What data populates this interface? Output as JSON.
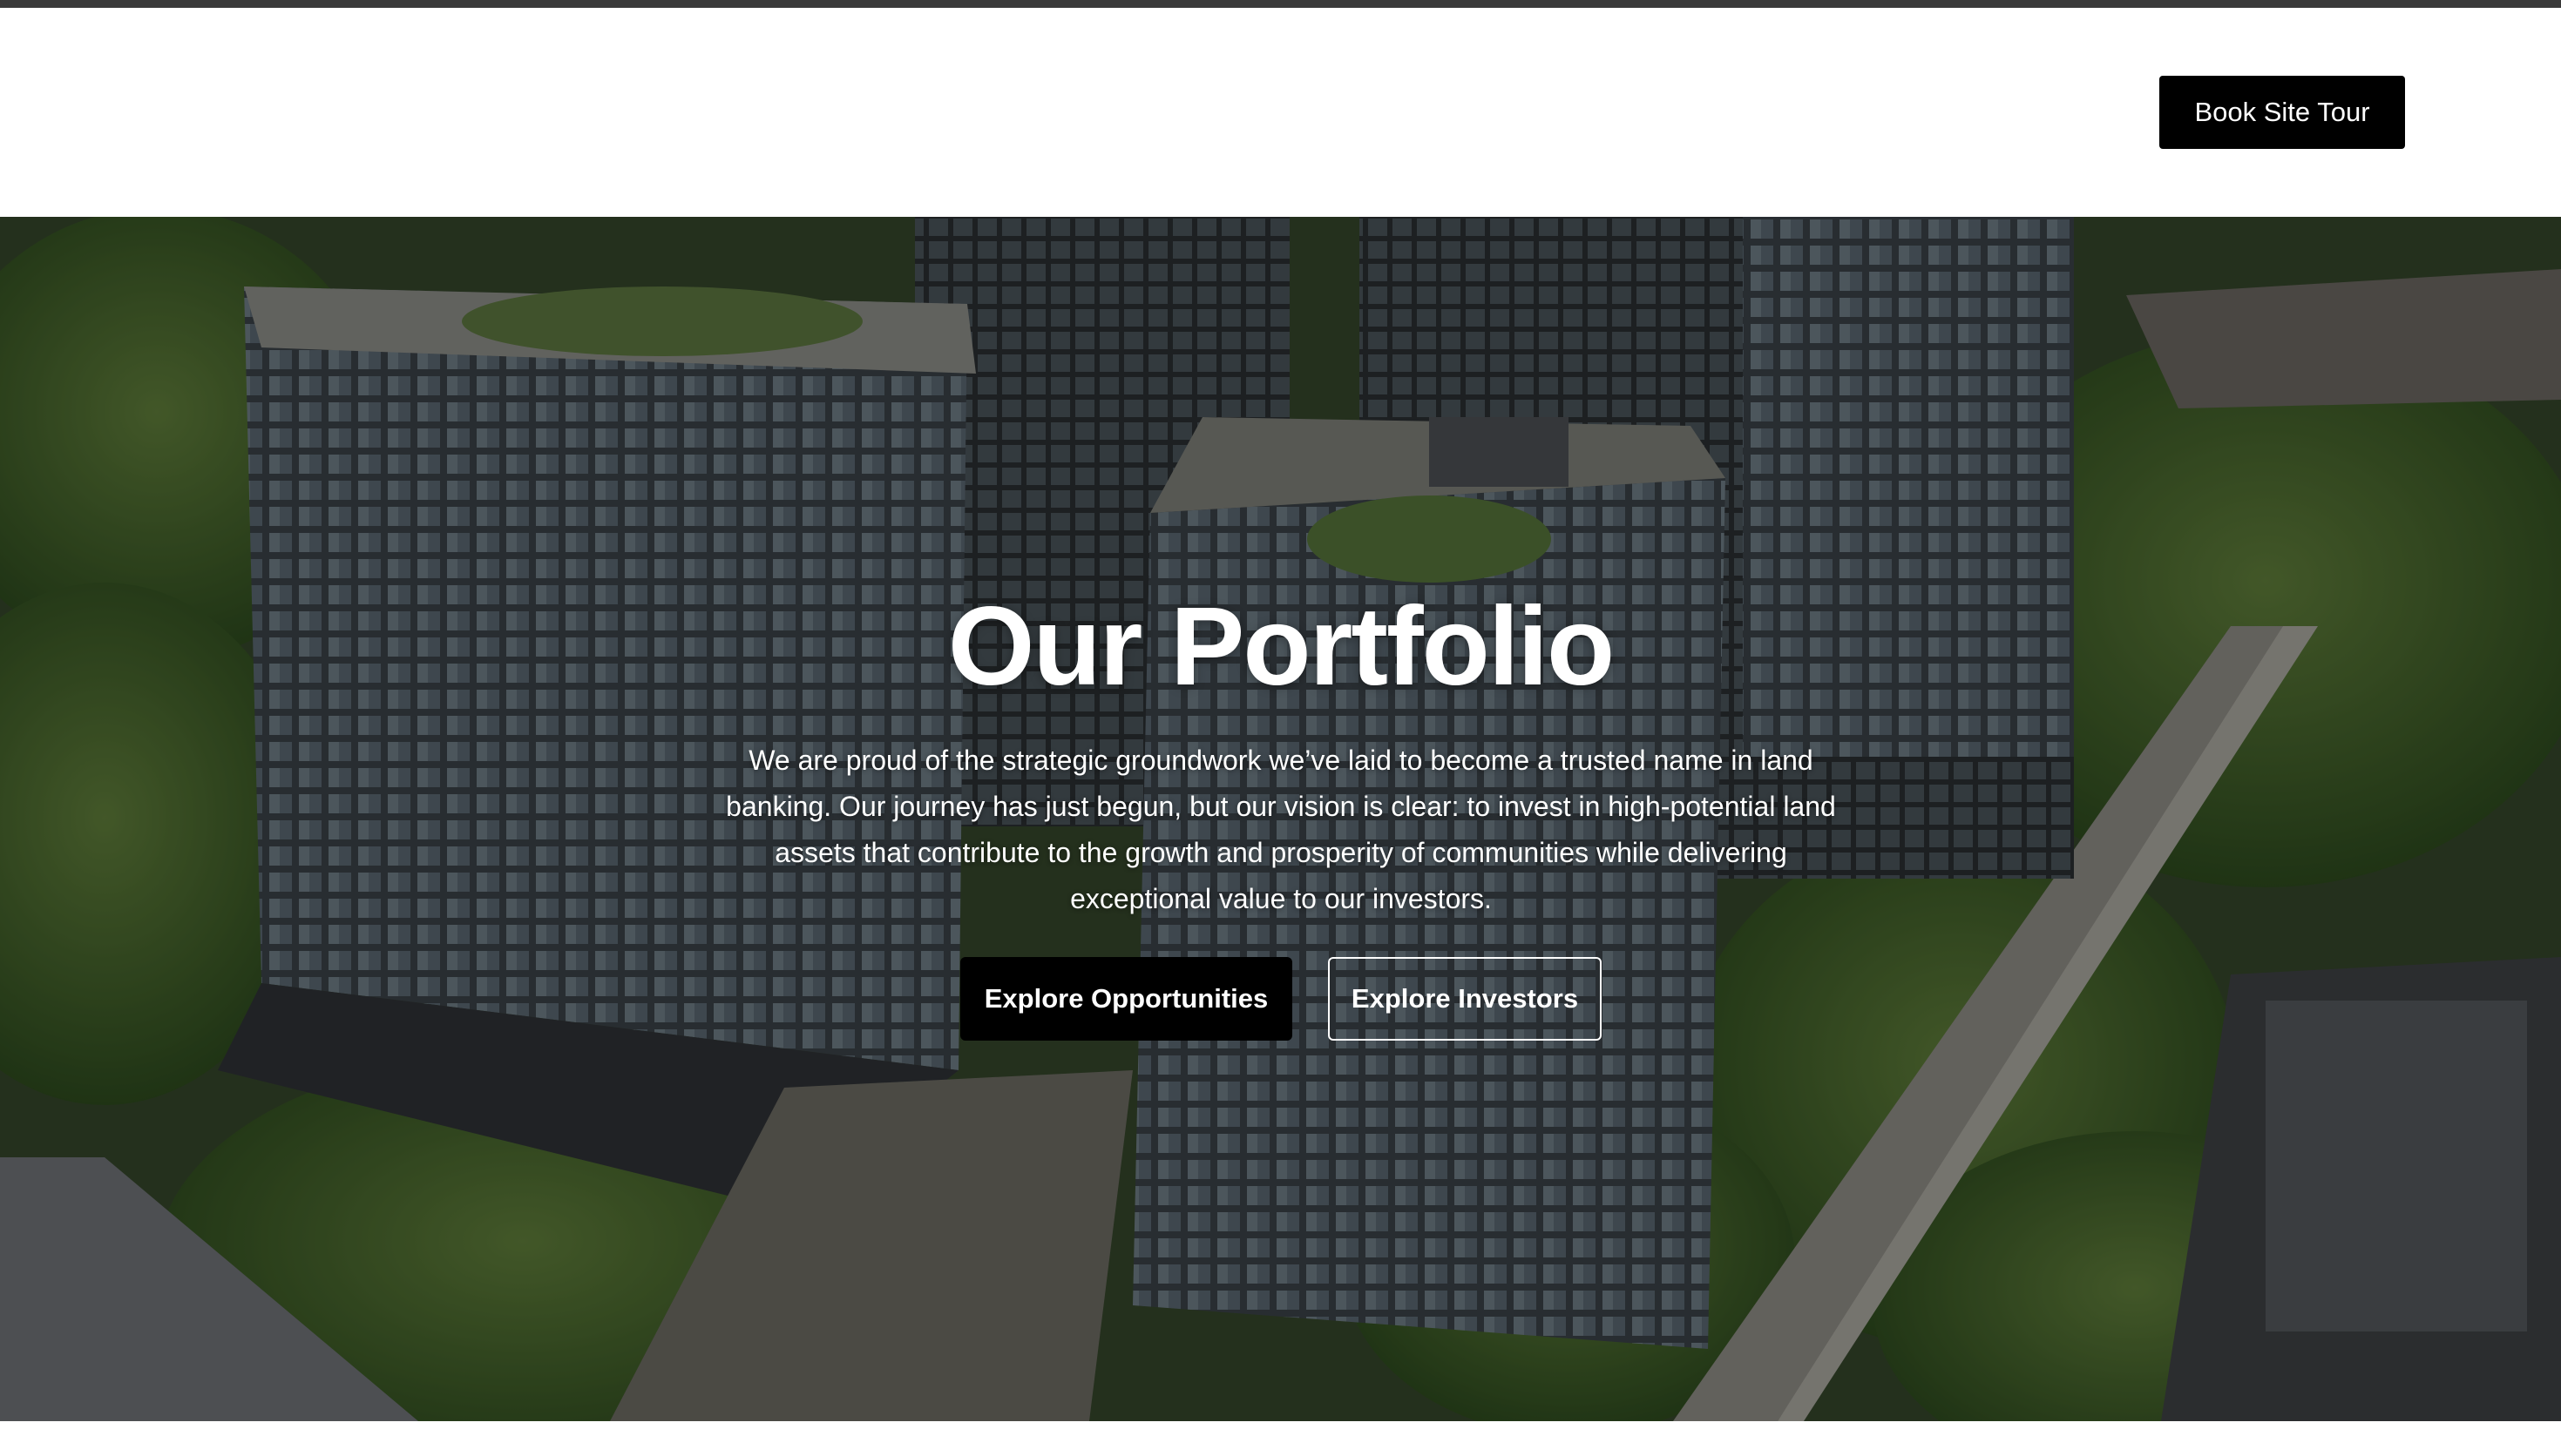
{
  "header": {
    "book_tour_label": "Book Site Tour"
  },
  "hero": {
    "title": "Our Portfolio",
    "description": "We are proud of the strategic groundwork we’ve laid to become a trusted name in land banking. Our journey has just begun, but our vision is clear: to invest in high-potential land assets that contribute to the growth and prosperity of communities while delivering exceptional value to our investors.",
    "primary_button_label": "Explore Opportunities",
    "secondary_button_label": "Explore Investors"
  },
  "colors": {
    "button_dark": "#000000",
    "text_light": "#ffffff",
    "top_bar": "#3a3a3a"
  }
}
